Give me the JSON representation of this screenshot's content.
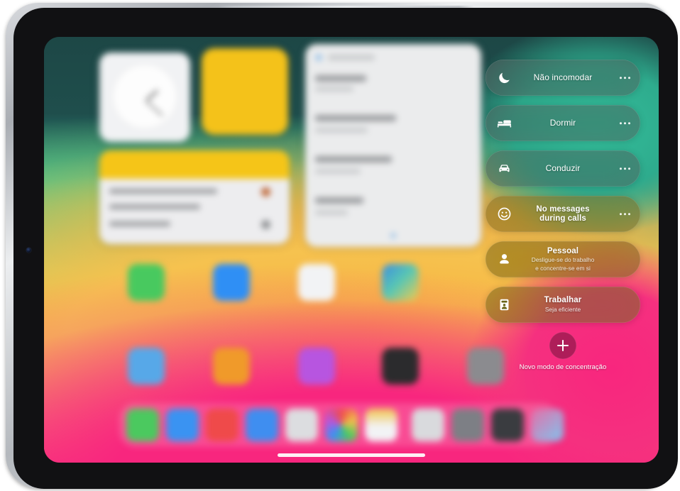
{
  "device": {
    "name": "iPad",
    "orientation": "landscape"
  },
  "screen": {
    "wallpaper_colors": {
      "teal_dark": "#1d4746",
      "teal": "#2eab8d",
      "green": "#8ede74",
      "orange": "#f0932f",
      "yellow": "#f6c24f",
      "salmon": "#f5647f",
      "pink": "#f8267e"
    }
  },
  "focus_panel": {
    "modes": [
      {
        "label": "Não incomodar",
        "subtitle": "",
        "icon": "moon-icon",
        "tint": "neutral",
        "more_label": "…"
      },
      {
        "label": "Dormir",
        "subtitle": "",
        "icon": "bed-icon",
        "tint": "neutral",
        "more_label": "…"
      },
      {
        "label": "Conduzir",
        "subtitle": "",
        "icon": "car-icon",
        "tint": "neutral",
        "more_label": "…"
      },
      {
        "label": "No messages during calls",
        "label_line1": "No messages",
        "label_line2": "during calls",
        "subtitle": "",
        "icon": "smiley-icon",
        "tint": "amber",
        "more_label": "…"
      },
      {
        "label": "Pessoal",
        "subtitle": "Desligue-se do trabalho e concentre-se em si",
        "subtitle_line1": "Desligue-se do trabalho",
        "subtitle_line2": "e concentre-se em si",
        "icon": "person-icon",
        "tint": "brown",
        "more_label": ""
      },
      {
        "label": "Trabalhar",
        "subtitle": "Seja eficiente",
        "icon": "id-badge-icon",
        "tint": "olive",
        "more_label": ""
      }
    ],
    "new_focus": {
      "button_icon": "plus-icon",
      "label": "Novo modo de concentração"
    }
  },
  "home_screen": {
    "widgets": [
      {
        "name": "clock-widget",
        "color": "#f1f2f4"
      },
      {
        "name": "yellow-widget",
        "color": "#f4c21a"
      },
      {
        "name": "notes-widget",
        "color": "#ededef"
      },
      {
        "name": "list-widget",
        "color": "#ebeced"
      }
    ],
    "app_icons_row1": [
      "#48c95f",
      "#2f8ff5",
      "#f2f3f5",
      "#3c8de0"
    ],
    "app_icons_row2": [
      "#57a8e8",
      "#f09a2a",
      "#b755e0",
      "#2b2b2d",
      "#8b8b8f"
    ],
    "dock_icons": [
      "#4bc95f",
      "#3a93f2",
      "#ef4a4a",
      "#3f8ef0",
      "#dcdde0",
      "#e2e3e6",
      "#f0c44c",
      "#d9dadd",
      "#7d7f85",
      "#3a3c40",
      "#e46fa8"
    ]
  }
}
